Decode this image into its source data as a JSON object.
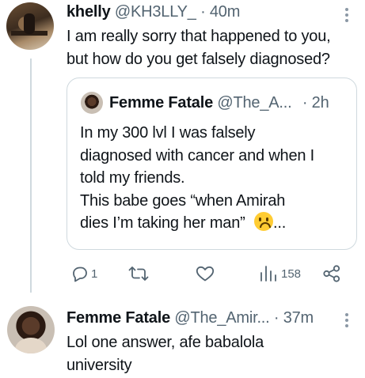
{
  "reply_tweet": {
    "author_name": "khelly",
    "handle": "@KH3LLY_",
    "time": "· 40m",
    "text_line1": "I am really sorry that happened to you,",
    "text_line2": "but how do you get falsely diagnosed?"
  },
  "quoted_tweet": {
    "author_name": "Femme Fatale",
    "handle": "@The_A...",
    "time": "· 2h",
    "line1": "In my 300 lvl I was falsely",
    "line2": "diagnosed with cancer and when I",
    "line3": "told my friends.",
    "line4": "This babe goes “when Amirah",
    "line5_start": "dies I’m taking her man” ",
    "line5_end": "...",
    "emoji_icon": "upside-down-face"
  },
  "actions": {
    "reply_count": "1",
    "retweet_count": "",
    "like_count": "",
    "views_count": "158"
  },
  "next_tweet": {
    "author_name": "Femme Fatale",
    "handle": "@The_Amir...",
    "time": "· 37m",
    "text_line1": "Lol one answer, afe babalola",
    "text_line2": "university"
  },
  "colors": {
    "text": "#0f1419",
    "secondary": "#536471",
    "border": "#cfd9de"
  }
}
